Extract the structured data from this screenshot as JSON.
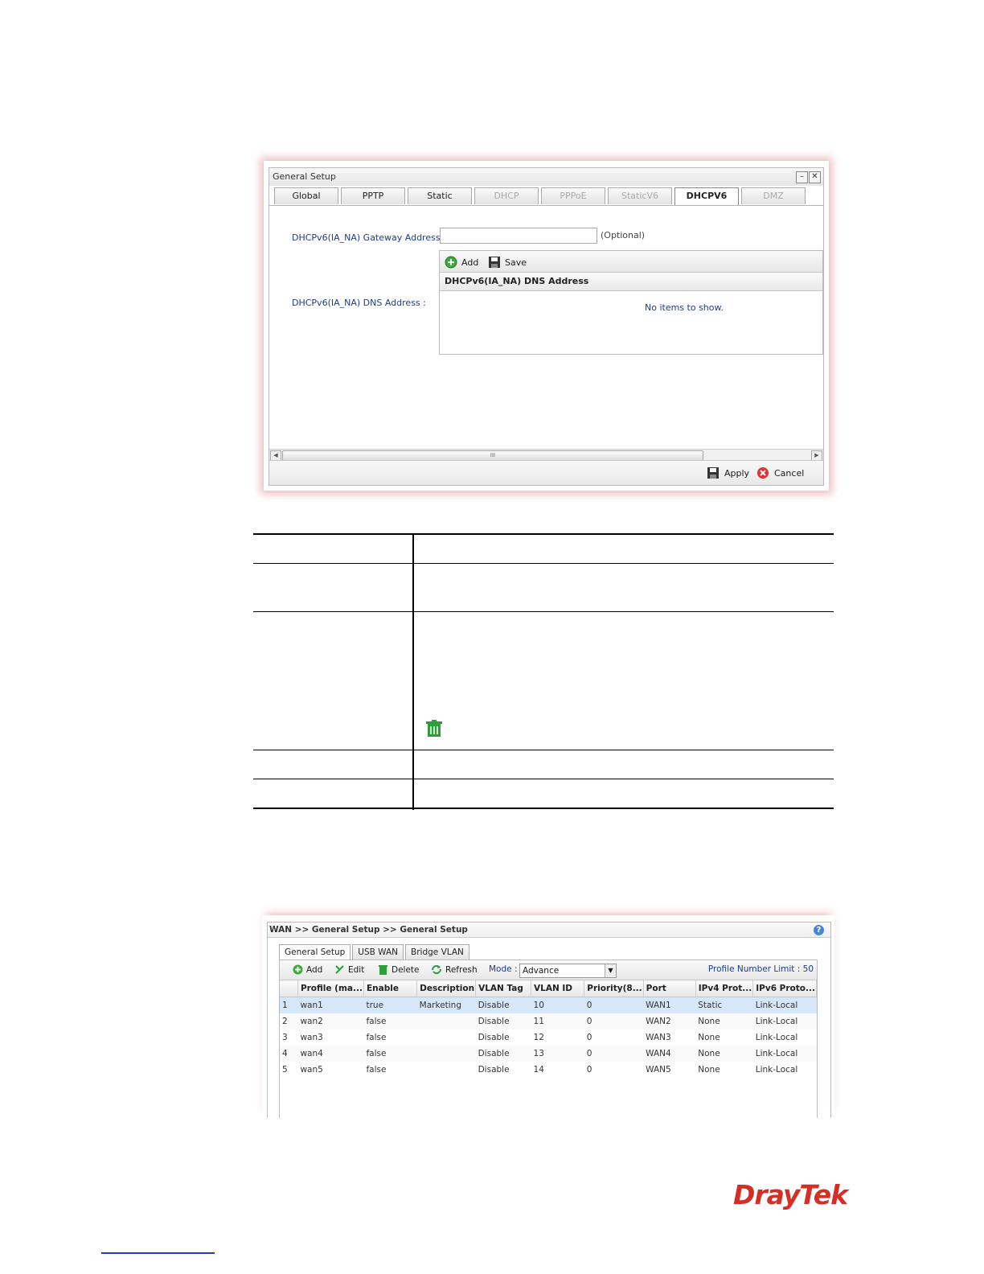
{
  "dialog": {
    "title": "General Setup",
    "minimize": "–",
    "close": "✕",
    "tabs": [
      {
        "label": "Global",
        "state": "normal"
      },
      {
        "label": "PPTP",
        "state": "normal"
      },
      {
        "label": "Static",
        "state": "normal"
      },
      {
        "label": "DHCP",
        "state": "disabled"
      },
      {
        "label": "PPPoE",
        "state": "disabled"
      },
      {
        "label": "StaticV6",
        "state": "disabled"
      },
      {
        "label": "DHCPV6",
        "state": "active"
      },
      {
        "label": "DMZ",
        "state": "disabled"
      }
    ],
    "gateway_label": "DHCPv6(IA_NA) Gateway Address :",
    "gateway_value": "",
    "gateway_hint": "(Optional)",
    "dns_label": "DHCPv6(IA_NA) DNS Address :",
    "grid": {
      "add_label": "Add",
      "save_label": "Save",
      "column": "DHCPv6(IA_NA) DNS Address",
      "empty_text": "No items to show."
    },
    "scroll_grip": "III",
    "apply_label": "Apply",
    "cancel_label": "Cancel"
  },
  "desc_icon": "trash-icon",
  "wan": {
    "breadcrumb": "WAN >> General Setup >> General Setup",
    "help": "?",
    "tabs": [
      {
        "label": "General Setup",
        "active": true
      },
      {
        "label": "USB WAN",
        "active": false
      },
      {
        "label": "Bridge VLAN",
        "active": false
      }
    ],
    "toolbar": {
      "add": "Add",
      "edit": "Edit",
      "delete": "Delete",
      "refresh": "Refresh",
      "mode_label": "Mode :",
      "mode_value": "Advance",
      "limit": "Profile Number Limit : 50"
    },
    "columns": [
      "",
      "Profile (ma...",
      "Enable",
      "Description",
      "VLAN Tag",
      "VLAN ID",
      "Priority(8...",
      "Port",
      "IPv4 Prot...",
      "IPv6 Proto..."
    ],
    "rows": [
      [
        "1",
        "wan1",
        "true",
        "Marketing",
        "Disable",
        "10",
        "0",
        "WAN1",
        "Static",
        "Link-Local"
      ],
      [
        "2",
        "wan2",
        "false",
        "",
        "Disable",
        "11",
        "0",
        "WAN2",
        "None",
        "Link-Local"
      ],
      [
        "3",
        "wan3",
        "false",
        "",
        "Disable",
        "12",
        "0",
        "WAN3",
        "None",
        "Link-Local"
      ],
      [
        "4",
        "wan4",
        "false",
        "",
        "Disable",
        "13",
        "0",
        "WAN4",
        "None",
        "Link-Local"
      ],
      [
        "5",
        "wan5",
        "false",
        "",
        "Disable",
        "14",
        "0",
        "WAN5",
        "None",
        "Link-Local"
      ]
    ]
  },
  "logo": "DrayTek",
  "colors": {
    "brand": "#d42e25",
    "label_blue": "#1f3c88",
    "selected_row": "#d7e7fa",
    "icon_green": "#2e9e3a"
  }
}
